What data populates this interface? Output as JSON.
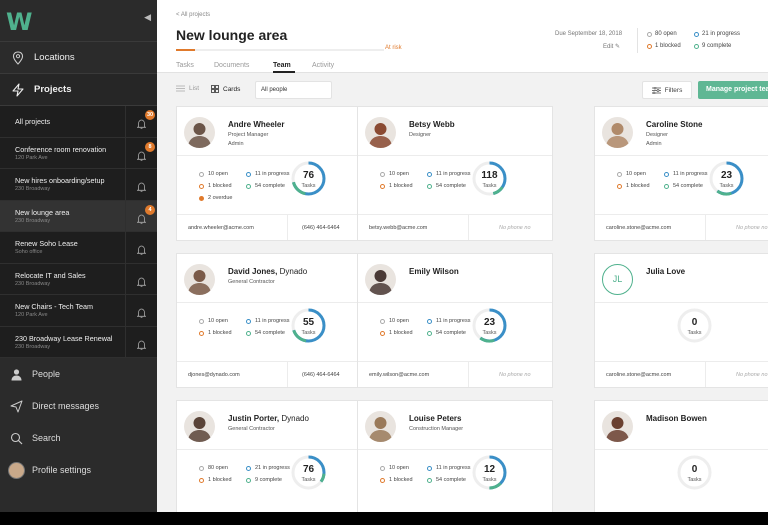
{
  "app": {
    "logo": "W"
  },
  "nav": {
    "locations": "Locations",
    "projects": "Projects",
    "people": "People",
    "messages": "Direct messages",
    "search": "Search",
    "profile": "Profile settings"
  },
  "projects": [
    {
      "name": "All projects",
      "address": "",
      "badge": "30"
    },
    {
      "name": "Conference room renovation",
      "address": "120 Park Ave",
      "badge": "8"
    },
    {
      "name": "New hires onboarding/setup",
      "address": "230 Broadway",
      "badge": ""
    },
    {
      "name": "New lounge area",
      "address": "230 Broadway",
      "badge": "4"
    },
    {
      "name": "Renew Soho Lease",
      "address": "Soho office",
      "badge": ""
    },
    {
      "name": "Relocate IT and Sales",
      "address": "230 Broadway",
      "badge": ""
    },
    {
      "name": "New Chairs - Tech Team",
      "address": "120 Park Ave",
      "badge": ""
    },
    {
      "name": "230 Broadway Lease Renewal",
      "address": "230 Broadway",
      "badge": ""
    }
  ],
  "header": {
    "breadcrumb": "< All projects",
    "title": "New lounge area",
    "status": "At risk",
    "progress": 0.09,
    "due": "Due September 18, 2018",
    "edit": "Edit",
    "tabs": [
      "Tasks",
      "Documents",
      "Team",
      "Activity"
    ],
    "active_tab": "Team",
    "stats": {
      "open": "80 open",
      "in_progress": "21 in progress",
      "blocked": "1 blocked",
      "complete": "9 complete"
    }
  },
  "toolbar": {
    "list": "List",
    "cards": "Cards",
    "people_filter": "All people",
    "filters": "Filters",
    "manage": "Manage project team"
  },
  "colors": {
    "accent": "#4fb18d",
    "risk": "#e07a2c",
    "progress": "#3a8fc7"
  },
  "members": [
    {
      "name": "Andre Wheeler",
      "company": "",
      "role": "Project Manager",
      "org": "Admin",
      "open": "10 open",
      "in_progress": "11 in progress",
      "blocked": "1 blocked",
      "complete": "54 complete",
      "overdue": "2 overdue",
      "tasks": "76",
      "tasks_label": "Tasks",
      "pct": 0.71,
      "email": "andre.wheeler@acme.com",
      "phone": "(646) 464-6464",
      "avatar_color": "#6b5548"
    },
    {
      "name": "Betsy Webb",
      "company": "",
      "role": "Designer",
      "org": "",
      "open": "10 open",
      "in_progress": "11 in progress",
      "blocked": "1 blocked",
      "complete": "54 complete",
      "overdue": "",
      "tasks": "118",
      "tasks_label": "Tasks",
      "pct": 0.46,
      "email": "betsy.webb@acme.com",
      "phone": "No phone no",
      "avatar_color": "#8a4a32"
    },
    {
      "name": "Caroline Stone",
      "company": "",
      "role": "Designer",
      "org": "Admin",
      "open": "10 open",
      "in_progress": "11 in progress",
      "blocked": "1 blocked",
      "complete": "54 complete",
      "overdue": "",
      "tasks": "23",
      "tasks_label": "Tasks",
      "pct": 0.6,
      "email": "caroline.stone@acme.com",
      "phone": "No phone no",
      "avatar_color": "#b08a6a"
    },
    {
      "name": "David Jones,",
      "company": "Dynado",
      "role": "General Contractor",
      "org": "",
      "open": "10 open",
      "in_progress": "11 in progress",
      "blocked": "1 blocked",
      "complete": "54 complete",
      "overdue": "",
      "tasks": "55",
      "tasks_label": "Tasks",
      "pct": 0.7,
      "email": "djones@dynado.com",
      "phone": "(646) 464-6464",
      "avatar_color": "#7a5a48"
    },
    {
      "name": "Emily Wilson",
      "company": "",
      "role": "",
      "org": "",
      "open": "10 open",
      "in_progress": "11 in progress",
      "blocked": "1 blocked",
      "complete": "54 complete",
      "overdue": "",
      "tasks": "23",
      "tasks_label": "Tasks",
      "pct": 0.6,
      "email": "emily.wilson@acme.com",
      "phone": "No phone no",
      "avatar_color": "#4a3a36"
    },
    {
      "name": "Julia Love",
      "company": "",
      "role": "",
      "org": "",
      "initials": "JL",
      "open": "",
      "in_progress": "",
      "blocked": "",
      "complete": "",
      "overdue": "",
      "tasks": "0",
      "tasks_label": "Tasks",
      "pct": 0,
      "email": "caroline.stone@acme.com",
      "phone": "No phone no",
      "avatar_color": ""
    },
    {
      "name": "Justin Porter,",
      "company": "Dynado",
      "role": "General Contractor",
      "org": "",
      "open": "80 open",
      "in_progress": "21 in progress",
      "blocked": "1 blocked",
      "complete": "9 complete",
      "overdue": "",
      "tasks": "76",
      "tasks_label": "Tasks",
      "pct": 0.35,
      "email": "",
      "phone": "",
      "avatar_color": "#5a4438"
    },
    {
      "name": "Louise Peters",
      "company": "",
      "role": "Construction Manager",
      "org": "",
      "open": "10 open",
      "in_progress": "11 in progress",
      "blocked": "1 blocked",
      "complete": "54 complete",
      "overdue": "",
      "tasks": "12",
      "tasks_label": "Tasks",
      "pct": 0.5,
      "email": "",
      "phone": "",
      "avatar_color": "#9a7a5a"
    },
    {
      "name": "Madison Bowen",
      "company": "",
      "role": "",
      "org": "",
      "open": "",
      "in_progress": "",
      "blocked": "",
      "complete": "",
      "overdue": "",
      "tasks": "0",
      "tasks_label": "Tasks",
      "pct": 0,
      "email": "",
      "phone": "",
      "avatar_color": "#6a4030"
    }
  ]
}
